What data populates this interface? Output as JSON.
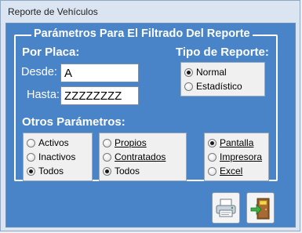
{
  "window": {
    "title": "Reporte de Vehículos"
  },
  "group": {
    "title": "Parámetros Para El Filtrado Del Reporte"
  },
  "placa": {
    "heading": "Por Placa:",
    "desde_label": "Desde:",
    "desde_value": "A",
    "hasta_label": "Hasta:",
    "hasta_value": "ZZZZZZZZ"
  },
  "tipo_reporte": {
    "heading": "Tipo de Reporte:",
    "options": [
      "Normal",
      "Estadístico"
    ],
    "selected": "Normal"
  },
  "otros": {
    "heading": "Otros Parámetros:",
    "estado": {
      "options": [
        "Activos",
        "Inactivos",
        "Todos"
      ],
      "selected": "Todos"
    },
    "propiedad": {
      "options": [
        "Propios",
        "Contratados",
        "Todos"
      ],
      "selected": "Todos"
    },
    "salida": {
      "options": [
        "Pantalla",
        "Impresora",
        "Excel"
      ],
      "selected": "Pantalla"
    }
  },
  "icons": {
    "print": "printer-icon",
    "exit": "exit-door-icon"
  }
}
